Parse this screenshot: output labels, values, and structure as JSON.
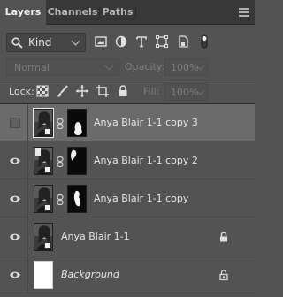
{
  "tabs": [
    {
      "label": "Layers",
      "active": true
    },
    {
      "label": "Channels",
      "active": false
    },
    {
      "label": "Paths",
      "active": false
    }
  ],
  "filter": {
    "kind_label": "Kind",
    "icons": [
      "image-filter-icon",
      "adjustment-filter-icon",
      "type-filter-icon",
      "shape-filter-icon",
      "smart-object-filter-icon",
      "filter-toggle-icon"
    ]
  },
  "blend": {
    "mode": "Normal",
    "opacity_label": "Opacity:",
    "opacity_value": "100%"
  },
  "lock": {
    "label": "Lock:",
    "fill_label": "Fill:",
    "fill_value": "100%"
  },
  "layers": [
    {
      "name": "Anya Blair 1-1 copy 3",
      "visible": false,
      "selected": true,
      "has_mask": true,
      "smart": true,
      "locked": false,
      "italic": false
    },
    {
      "name": "Anya Blair 1-1 copy 2",
      "visible": true,
      "selected": false,
      "has_mask": true,
      "smart": true,
      "locked": false,
      "italic": false
    },
    {
      "name": "Anya Blair 1-1 copy",
      "visible": true,
      "selected": false,
      "has_mask": true,
      "smart": true,
      "locked": false,
      "italic": false
    },
    {
      "name": "Anya Blair 1-1",
      "visible": true,
      "selected": false,
      "has_mask": false,
      "smart": true,
      "locked": true,
      "italic": false
    },
    {
      "name": "Background",
      "visible": true,
      "selected": false,
      "has_mask": false,
      "smart": false,
      "locked": true,
      "italic": true
    }
  ],
  "colors": {
    "panel_bg": "#535353",
    "tabbar_bg": "#383838",
    "selected_row": "#6b6b6b"
  }
}
